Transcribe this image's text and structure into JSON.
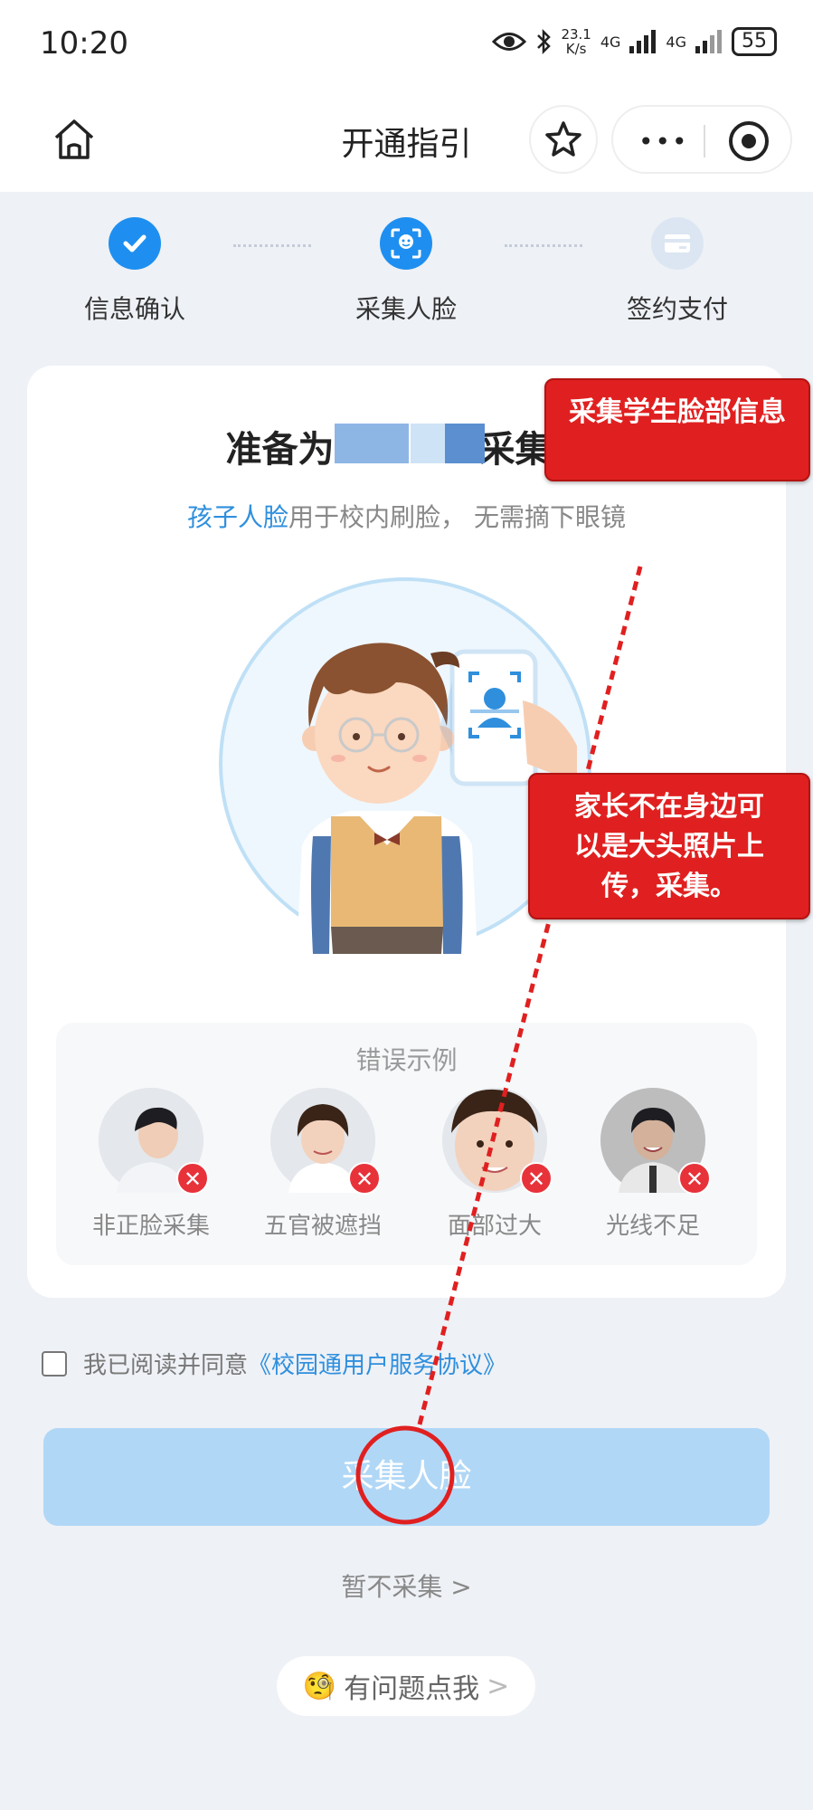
{
  "status_bar": {
    "time": "10:20",
    "net_speed_top": "23.1",
    "net_speed_bottom": "K/s",
    "signal1": "4G",
    "signal2": "4G",
    "battery": "55"
  },
  "nav": {
    "title": "开通指引",
    "more_label": "•••"
  },
  "steps": [
    {
      "label": "信息确认",
      "state": "done",
      "icon": "check-icon"
    },
    {
      "label": "采集人脸",
      "state": "active",
      "icon": "face-scan-icon"
    },
    {
      "label": "签约支付",
      "state": "pending",
      "icon": "card-icon"
    }
  ],
  "card": {
    "title_prefix": "准备为",
    "title_suffix": "采集人",
    "subtitle_highlight": "孩子人脸",
    "subtitle_rest": "用于校内刷脸， 无需摘下眼镜",
    "error_title": "错误示例",
    "errors": [
      {
        "label": "非正脸采集"
      },
      {
        "label": "五官被遮挡"
      },
      {
        "label": "面部过大"
      },
      {
        "label": "光线不足"
      }
    ],
    "error_mark": "✕"
  },
  "agreement": {
    "text": "我已阅读并同意",
    "link": "《校园通用户服务协议》"
  },
  "primary_button": "采集人脸",
  "skip_link": "暂不采集 >",
  "help": {
    "emoji": "🧐",
    "label": "有问题点我",
    "chevron": ">"
  },
  "annotations": {
    "note1": "采集学生脸部信息",
    "note2_line1": "家长不在身边可",
    "note2_line2": "以是大头照片上",
    "note2_line3": "传，采集。"
  },
  "colors": {
    "accent": "#2f8fdd",
    "button_disabled": "#b1d7f6",
    "annotation_red": "#e02020"
  }
}
